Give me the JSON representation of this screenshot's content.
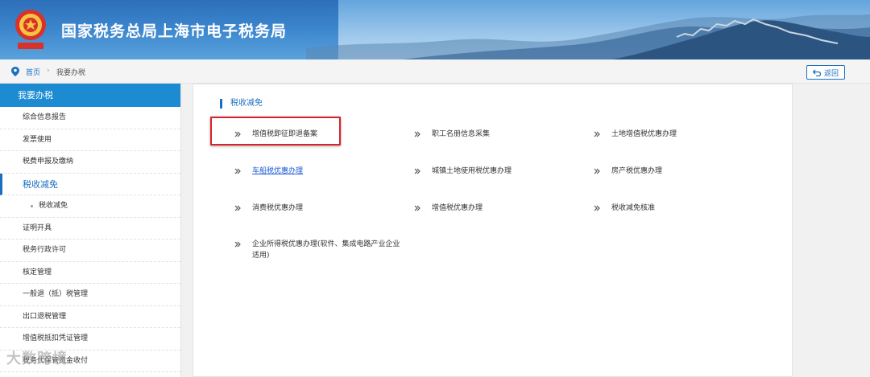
{
  "header": {
    "site_title": "国家税务总局上海市电子税务局"
  },
  "breadcrumb": {
    "home": "首页",
    "separator": "›",
    "current": "我要办税",
    "back_label": "返回"
  },
  "sidebar": {
    "heading": "我要办税",
    "items": [
      {
        "label": "综合信息报告"
      },
      {
        "label": "发票使用"
      },
      {
        "label": "税费申报及缴纳"
      },
      {
        "label": "税收减免",
        "active": true
      },
      {
        "label": "税收减免",
        "sub": true
      },
      {
        "label": "证明开具"
      },
      {
        "label": "税务行政许可"
      },
      {
        "label": "核定管理"
      },
      {
        "label": "一般退（抵）税管理"
      },
      {
        "label": "出口退税管理"
      },
      {
        "label": "增值税抵扣凭证管理"
      },
      {
        "label": "税务代保管资金收付"
      }
    ]
  },
  "main": {
    "section_title": "税收减免",
    "options": [
      {
        "label": "增值税即征即退备案",
        "highlighted": true
      },
      {
        "label": "职工名册信息采集"
      },
      {
        "label": "土地增值税优惠办理"
      },
      {
        "label": "车船税优惠办理",
        "link": true
      },
      {
        "label": "城镇土地使用税优惠办理"
      },
      {
        "label": "房产税优惠办理"
      },
      {
        "label": "消费税优惠办理"
      },
      {
        "label": "增值税优惠办理"
      },
      {
        "label": "税收减免核准"
      },
      {
        "label": "企业所得税优惠办理(软件、集成电路产业企业适用)"
      }
    ]
  },
  "watermark": "大数跨境",
  "colors": {
    "accent": "#1c8bd2",
    "highlight_border": "#d9232a",
    "link": "#1b5bd2"
  }
}
